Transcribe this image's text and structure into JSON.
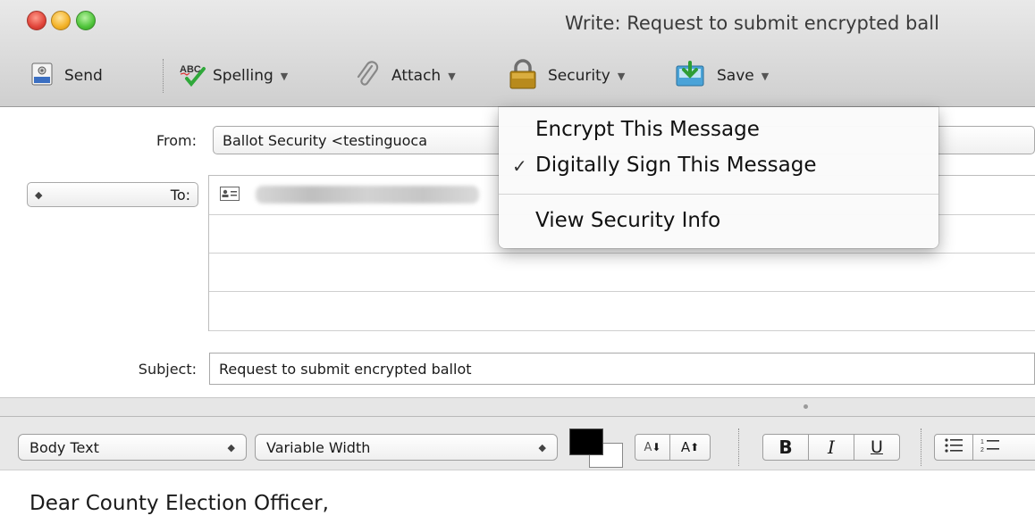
{
  "window": {
    "title": "Write: Request to submit encrypted ball"
  },
  "toolbar": {
    "send_label": "Send",
    "spelling_label": "Spelling",
    "attach_label": "Attach",
    "security_label": "Security",
    "save_label": "Save"
  },
  "header": {
    "from_label": "From:",
    "from_value": "Ballot Security <testinguoca",
    "to_label": "To:",
    "subject_label": "Subject:",
    "subject_value": "Request to submit encrypted ballot"
  },
  "format_bar": {
    "paragraph_style": "Body Text",
    "font": "Variable Width",
    "text_color": "#000000",
    "smaller_label": "A",
    "larger_label": "A",
    "bold_label": "B",
    "italic_label": "I",
    "underline_label": "U"
  },
  "security_menu": {
    "items": [
      {
        "label": "Encrypt This Message",
        "checked": false
      },
      {
        "label": "Digitally Sign This Message",
        "checked": true
      },
      {
        "label": "View Security Info",
        "checked": false
      }
    ],
    "checkmark": "✓"
  },
  "message": {
    "body_first_line": "Dear County Election Officer,"
  }
}
